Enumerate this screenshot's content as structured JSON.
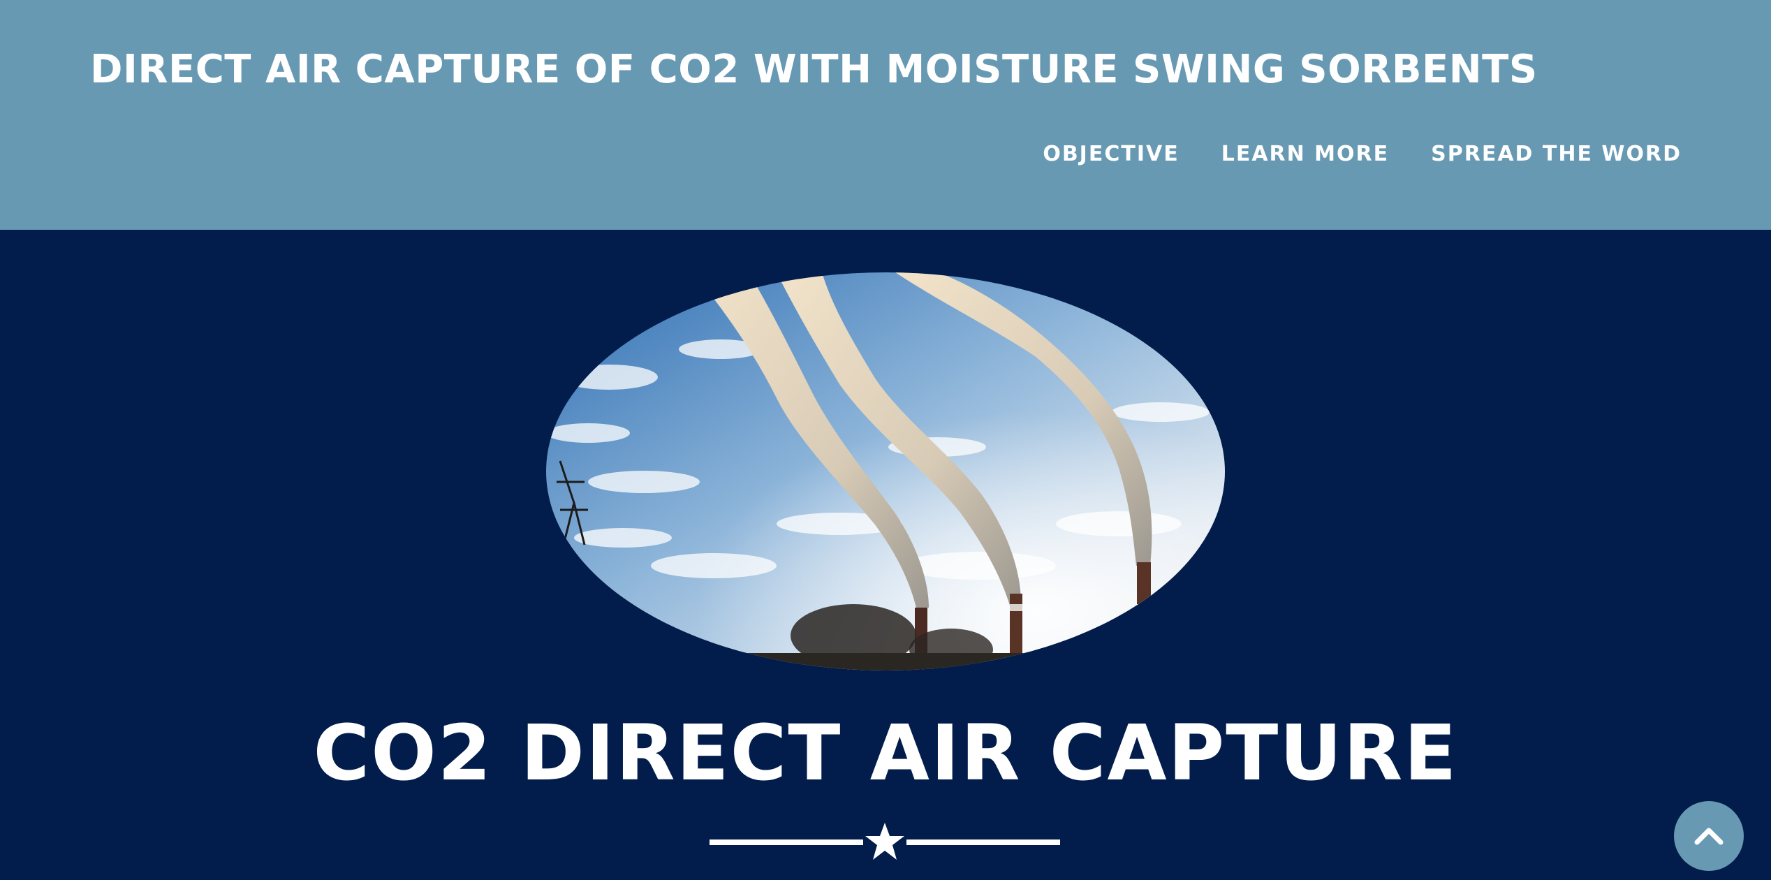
{
  "site": {
    "title": "DIRECT AIR CAPTURE OF CO2 WITH MOISTURE SWING SORBENTS"
  },
  "nav": {
    "items": [
      {
        "label": "OBJECTIVE"
      },
      {
        "label": "LEARN MORE"
      },
      {
        "label": "SPREAD THE WORD"
      }
    ]
  },
  "hero": {
    "image_description_icon": "smokestacks-sky-photo",
    "title": "CO2 DIRECT AIR CAPTURE",
    "divider_icon": "star-icon"
  },
  "scroll_top": {
    "icon": "chevron-up-icon"
  },
  "colors": {
    "navbar_bg": "#6799b3",
    "hero_bg": "#021d4b",
    "text": "#ffffff"
  }
}
